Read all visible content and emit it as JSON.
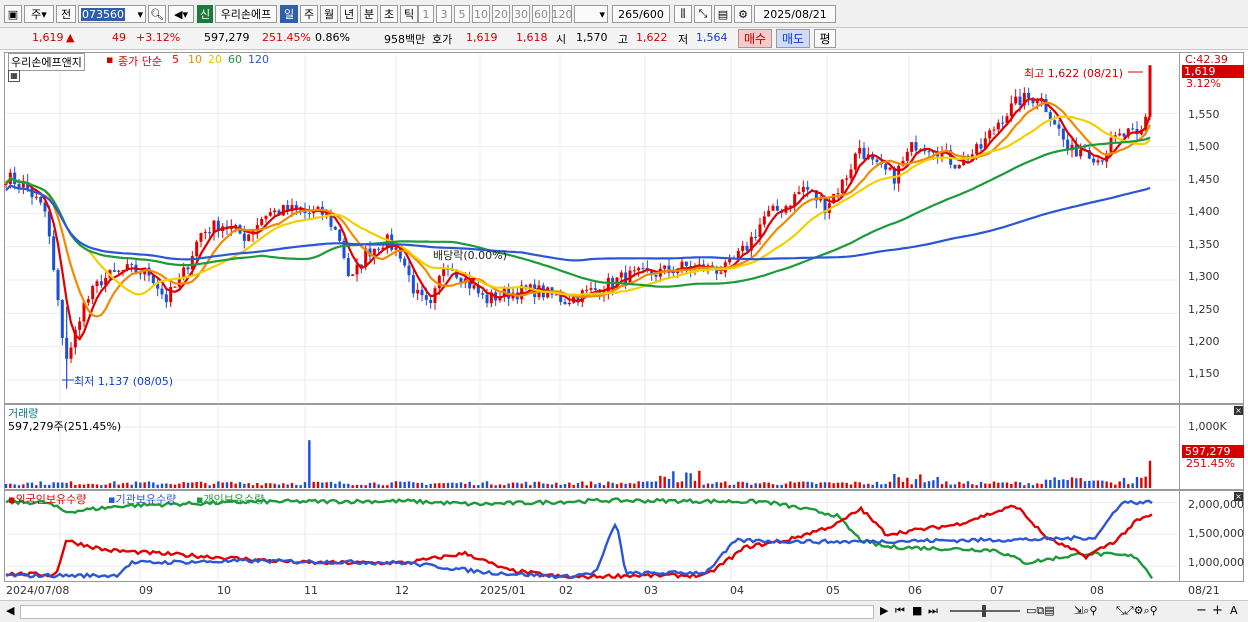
{
  "toolbar": {
    "type_label": "주",
    "prev_label": "전",
    "code": "073560",
    "badge_new": "신",
    "stock_name": "우리손에프",
    "periods": [
      "일",
      "주",
      "월",
      "년",
      "분",
      "초",
      "틱"
    ],
    "selected_period": "일",
    "minute_units": [
      "1",
      "3",
      "5",
      "10",
      "20",
      "30",
      "60",
      "120"
    ],
    "count": "265",
    "count_max": "/600",
    "date": "2025/08/21"
  },
  "quote": {
    "price": "1,619",
    "arrow": "▲",
    "change": "49",
    "change_pct": "+3.12%",
    "volume": "597,279",
    "volume_ratio": "251.45%",
    "turnover": "0.86%",
    "amount": "958백만",
    "bid_label": "호가",
    "ask_price": "1,619",
    "bid_price": "1,618",
    "open_label": "시",
    "open": "1,570",
    "high_label": "고",
    "high": "1,622",
    "low_label": "저",
    "low": "1,564",
    "buy_label": "매수",
    "sell_label": "매도",
    "eval_label": "평"
  },
  "price_pane": {
    "name_tag": "우리손에프앤지",
    "ma_label": "종가 단순",
    "ma_periods": [
      "5",
      "10",
      "20",
      "60",
      "120"
    ],
    "ma_colors": [
      "#e00000",
      "#f08a00",
      "#f2d000",
      "#1f9a3a",
      "#2b57d6"
    ],
    "high_marker": "최고 1,622 (08/21)",
    "low_marker": "최저 1,137 (08/05)",
    "dividend_marker": "배당락(0.00%)",
    "price_axis_labels": [
      "1,550",
      "1,500",
      "1,450",
      "1,400",
      "1,350",
      "1,300",
      "1,250",
      "1,200",
      "1,150"
    ],
    "price_axis_values": [
      1550,
      1500,
      1450,
      1400,
      1350,
      1300,
      1250,
      1200,
      1150
    ],
    "corner_info": "C:42.39",
    "last_price_tag": "1,619",
    "last_pct_tag": "3.12%"
  },
  "volume_pane": {
    "title": "거래량",
    "value": "597,279주(251.45%)",
    "axis_label": "1,000K",
    "last_tag": "597,279",
    "last_pct": "251.45%"
  },
  "holding_pane": {
    "legend": [
      {
        "label": "외국인보유수량",
        "color": "#e00000"
      },
      {
        "label": "기관보유수량",
        "color": "#2b57d6"
      },
      {
        "label": "개인보유수량",
        "color": "#1f9a3a"
      }
    ],
    "axis_labels": [
      "2,000,000",
      "1,500,000",
      "1,000,000"
    ],
    "axis_values": [
      2000000,
      1500000,
      1000000
    ]
  },
  "x_axis": {
    "labels": [
      "2024/07/08",
      "09",
      "10",
      "11",
      "12",
      "2025/01",
      "02",
      "03",
      "04",
      "05",
      "06",
      "07",
      "08",
      "08/21"
    ]
  },
  "chart_data": {
    "type": "line",
    "price_range": [
      1120,
      1630
    ],
    "volume_max": 1000000,
    "holdings_range": [
      780000,
      2100000
    ]
  }
}
